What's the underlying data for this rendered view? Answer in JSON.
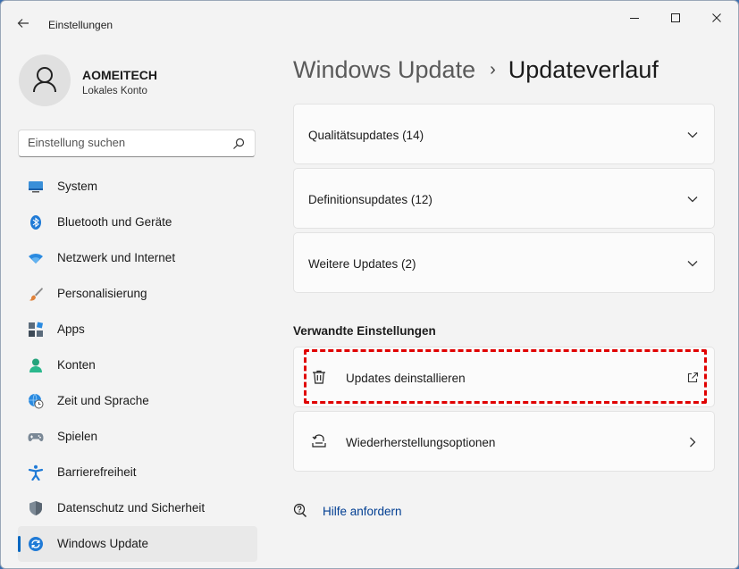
{
  "window": {
    "title": "Einstellungen"
  },
  "user": {
    "name": "AOMEITECH",
    "account_type": "Lokales Konto"
  },
  "search": {
    "placeholder": "Einstellung suchen"
  },
  "sidebar": {
    "items": [
      {
        "label": "System",
        "icon": "system-icon"
      },
      {
        "label": "Bluetooth und Geräte",
        "icon": "bluetooth-icon"
      },
      {
        "label": "Netzwerk und Internet",
        "icon": "wifi-icon"
      },
      {
        "label": "Personalisierung",
        "icon": "brush-icon"
      },
      {
        "label": "Apps",
        "icon": "apps-icon"
      },
      {
        "label": "Konten",
        "icon": "person-icon"
      },
      {
        "label": "Zeit und Sprache",
        "icon": "globe-clock-icon"
      },
      {
        "label": "Spielen",
        "icon": "gamepad-icon"
      },
      {
        "label": "Barrierefreiheit",
        "icon": "accessibility-icon"
      },
      {
        "label": "Datenschutz und Sicherheit",
        "icon": "shield-icon"
      },
      {
        "label": "Windows Update",
        "icon": "update-icon",
        "active": true
      }
    ]
  },
  "breadcrumb": {
    "parent": "Windows Update",
    "separator": "›",
    "current": "Updateverlauf"
  },
  "history": {
    "groups": [
      {
        "label": "Qualitätsupdates (14)"
      },
      {
        "label": "Definitionsupdates (12)"
      },
      {
        "label": "Weitere Updates (2)"
      }
    ]
  },
  "related": {
    "title": "Verwandte Einstellungen",
    "uninstall_label": "Updates deinstallieren",
    "recovery_label": "Wiederherstellungsoptionen"
  },
  "help": {
    "label": "Hilfe anfordern"
  },
  "colors": {
    "accent": "#0067c0",
    "highlight": "#e00000",
    "link": "#003e92"
  }
}
